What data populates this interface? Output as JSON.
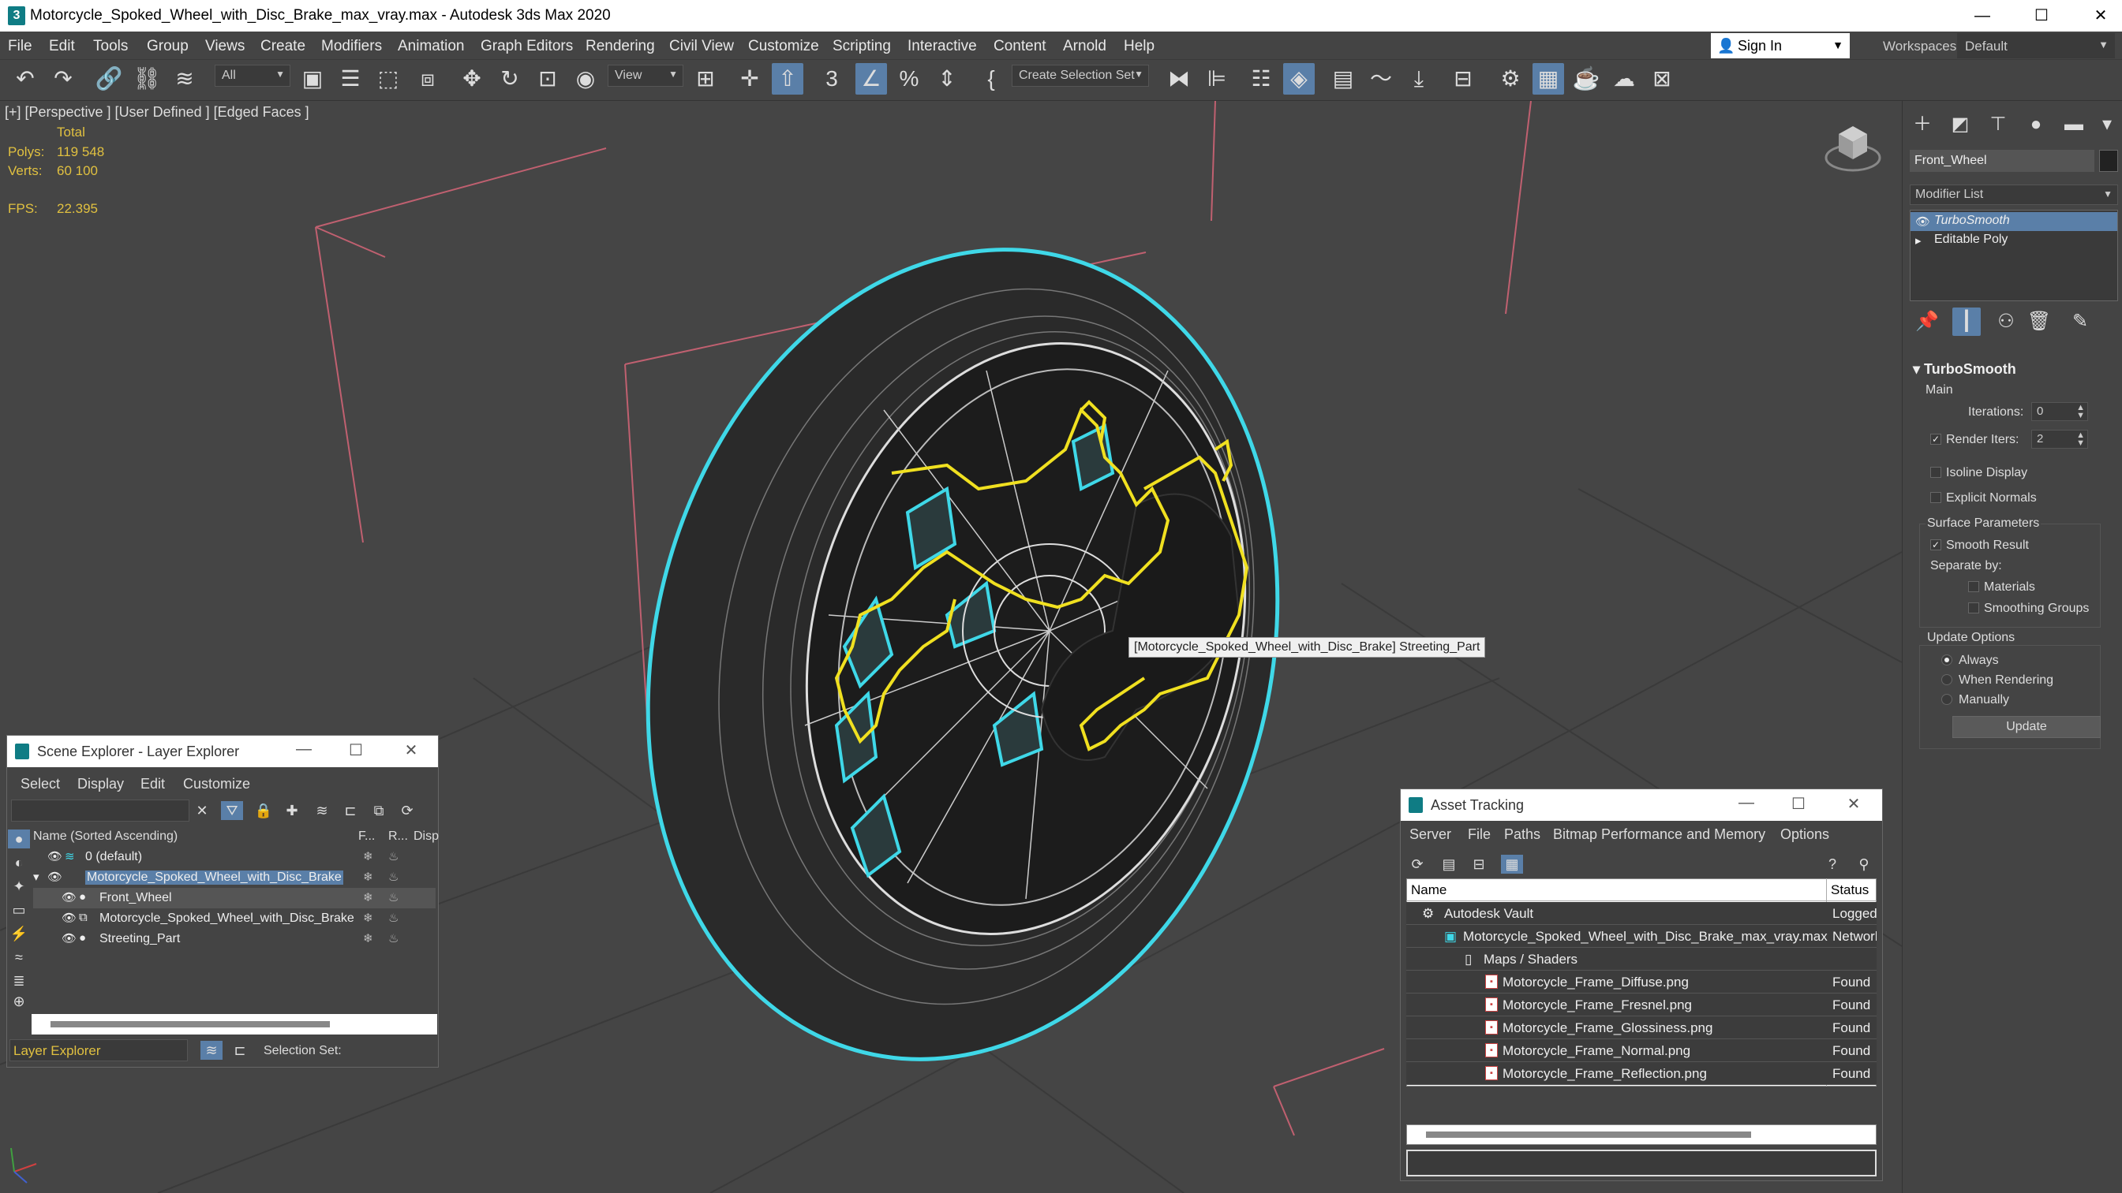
{
  "window": {
    "title": "Motorcycle_Spoked_Wheel_with_Disc_Brake_max_vray.max - Autodesk 3ds Max 2020",
    "minimize": "—",
    "maximize": "☐",
    "close": "✕"
  },
  "menu": [
    "File",
    "Edit",
    "Tools",
    "Group",
    "Views",
    "Create",
    "Modifiers",
    "Animation",
    "Graph Editors",
    "Rendering",
    "Civil View",
    "Customize",
    "Scripting",
    "Interactive",
    "Content",
    "Arnold",
    "Help"
  ],
  "account": {
    "sign_in": "Sign In",
    "workspaces_label": "Workspaces:",
    "workspace": "Default"
  },
  "toolbar": {
    "filter": "All",
    "ref_coord": "View",
    "selection_set": "Create Selection Set"
  },
  "viewport": {
    "label": "[+] [Perspective ] [User Defined ] [Edged Faces ]",
    "stats": {
      "total_label": "Total",
      "polys_label": "Polys:",
      "polys": "119 548",
      "verts_label": "Verts:",
      "verts": "60 100",
      "fps_label": "FPS:",
      "fps": "22.395"
    },
    "tooltip": "[Motorcycle_Spoked_Wheel_with_Disc_Brake] Streeting_Part"
  },
  "command_panel": {
    "object_name": "Front_Wheel",
    "modifier_list": "Modifier List",
    "stack": [
      {
        "label": "TurboSmooth",
        "selected": true
      },
      {
        "label": "Editable Poly",
        "selected": false
      }
    ],
    "rollout_title": "TurboSmooth",
    "main_label": "Main",
    "iterations_label": "Iterations:",
    "iterations": "0",
    "render_iters_label": "Render Iters:",
    "render_iters": "2",
    "isoline_display": "Isoline Display",
    "explicit_normals": "Explicit Normals",
    "surface_params": "Surface Parameters",
    "smooth_result": "Smooth Result",
    "separate_by": "Separate by:",
    "materials": "Materials",
    "smoothing_groups": "Smoothing Groups",
    "update_options": "Update Options",
    "always": "Always",
    "when_rendering": "When Rendering",
    "manually": "Manually",
    "update_button": "Update"
  },
  "scene_explorer": {
    "title": "Scene Explorer - Layer Explorer",
    "menu": [
      "Select",
      "Display",
      "Edit",
      "Customize"
    ],
    "columns": {
      "name": "Name (Sorted Ascending)",
      "freeze": "F...",
      "render": "R...",
      "display": "Disp"
    },
    "rows": [
      {
        "label": "0 (default)",
        "level": 0
      },
      {
        "label": "Motorcycle_Spoked_Wheel_with_Disc_Brake",
        "level": 0
      },
      {
        "label": "Front_Wheel",
        "level": 1
      },
      {
        "label": "Motorcycle_Spoked_Wheel_with_Disc_Brake",
        "level": 1
      },
      {
        "label": "Streeting_Part",
        "level": 1
      }
    ],
    "footer_dropdown": "Layer Explorer",
    "selection_set_label": "Selection Set:"
  },
  "asset_tracking": {
    "title": "Asset Tracking",
    "menu": [
      "Server",
      "File",
      "Paths",
      "Bitmap Performance and Memory",
      "Options"
    ],
    "columns": {
      "name": "Name",
      "status": "Status"
    },
    "rows": [
      {
        "name": "Autodesk Vault",
        "status": "Logged"
      },
      {
        "name": "Motorcycle_Spoked_Wheel_with_Disc_Brake_max_vray.max",
        "status": "Network"
      },
      {
        "name": "Maps / Shaders",
        "status": ""
      },
      {
        "name": "Motorcycle_Frame_Diffuse.png",
        "status": "Found"
      },
      {
        "name": "Motorcycle_Frame_Fresnel.png",
        "status": "Found"
      },
      {
        "name": "Motorcycle_Frame_Glossiness.png",
        "status": "Found"
      },
      {
        "name": "Motorcycle_Frame_Normal.png",
        "status": "Found"
      },
      {
        "name": "Motorcycle_Frame_Reflection.png",
        "status": "Found"
      }
    ]
  },
  "colors": {
    "selection": "#5a7fa8",
    "wire_cyan": "#3fd8e8",
    "wire_yellow": "#f0e020",
    "stats": "#e0c040"
  }
}
